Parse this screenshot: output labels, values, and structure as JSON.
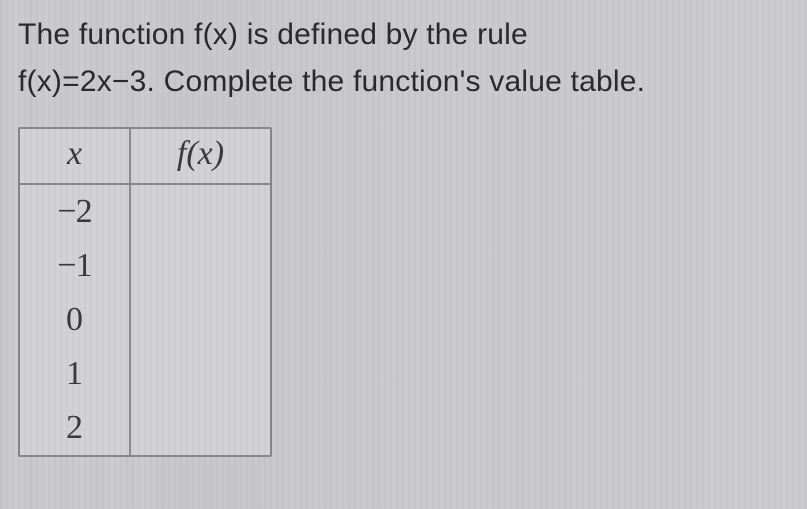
{
  "question": {
    "line1": "The function f(x) is defined by the rule",
    "line2": "f(x)=2x−3. Complete the function's value table."
  },
  "chart_data": {
    "type": "table",
    "title": "",
    "columns": [
      "x",
      "f(x)"
    ],
    "rows": [
      {
        "x": "−2",
        "fx": ""
      },
      {
        "x": "−1",
        "fx": ""
      },
      {
        "x": "0",
        "fx": ""
      },
      {
        "x": "1",
        "fx": ""
      },
      {
        "x": "2",
        "fx": ""
      }
    ]
  }
}
